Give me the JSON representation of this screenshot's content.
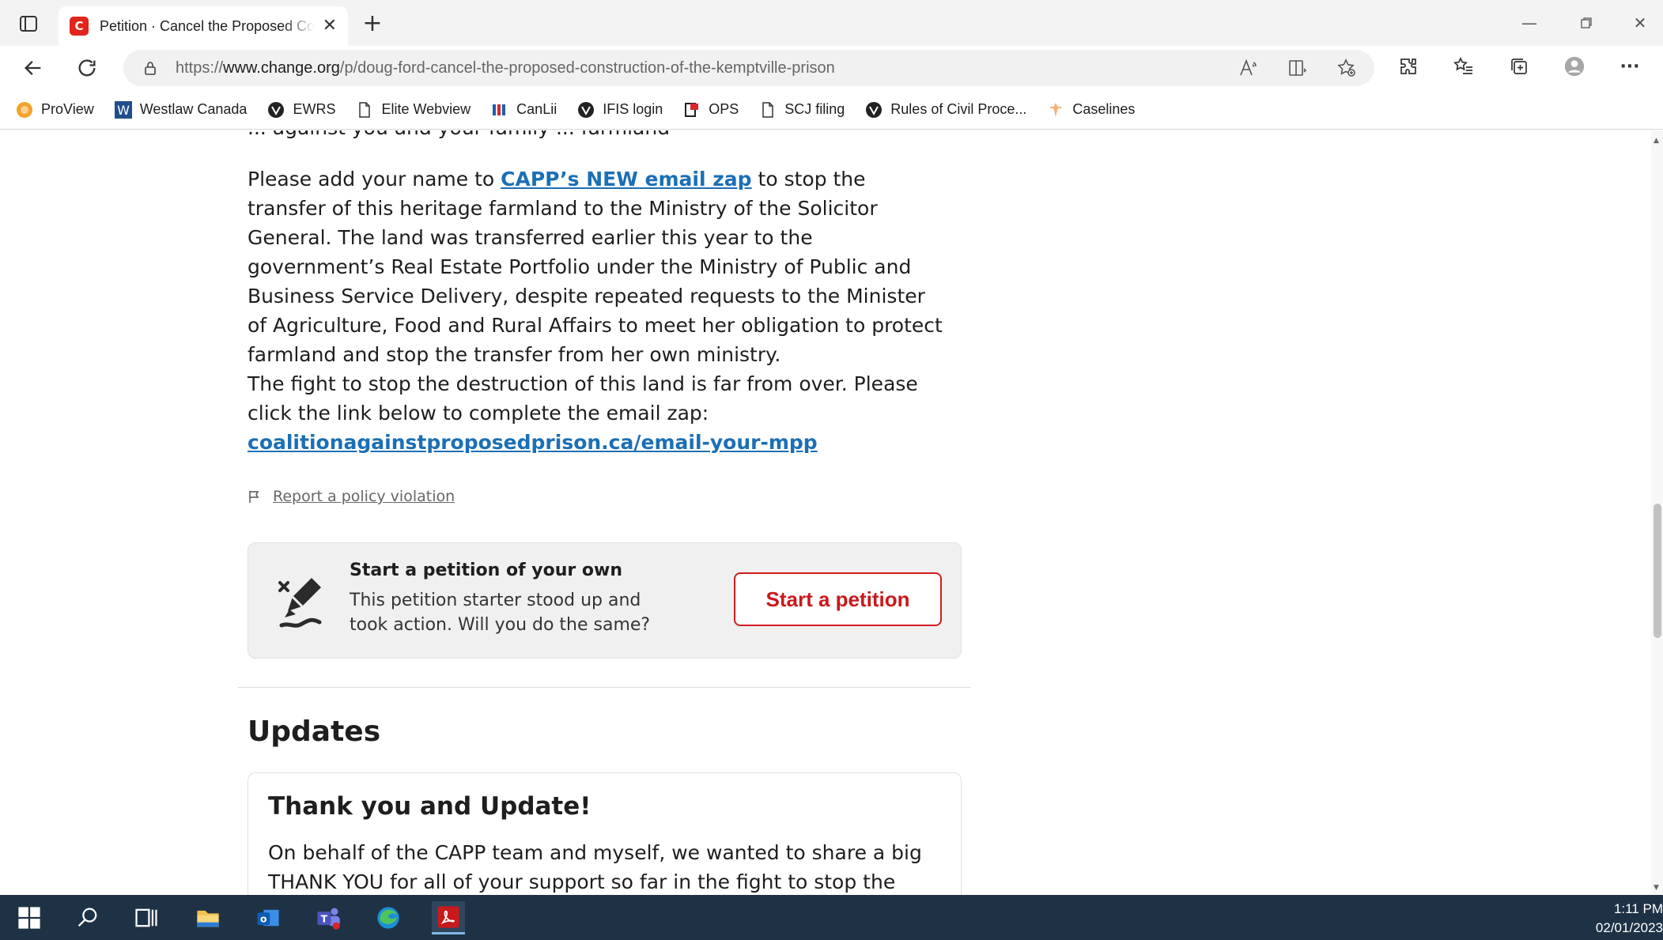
{
  "browser": {
    "tab_title": "Petition · Cancel the Proposed Construction of the Kemptville Prison",
    "tab_favicon_letter": "C",
    "url_prefix": "https://",
    "url_domain": "www.change.org",
    "url_path": "/p/doug-ford-cancel-the-proposed-construction-of-the-kemptville-prison"
  },
  "bookmarks": [
    {
      "label": "ProView",
      "icon": "proview-icon"
    },
    {
      "label": "Westlaw Canada",
      "icon": "westlaw-icon"
    },
    {
      "label": "EWRS",
      "icon": "shield-icon"
    },
    {
      "label": "Elite Webview",
      "icon": "page-icon"
    },
    {
      "label": "CanLii",
      "icon": "canlii-icon"
    },
    {
      "label": "IFIS login",
      "icon": "shield-icon"
    },
    {
      "label": "OPS",
      "icon": "ops-icon"
    },
    {
      "label": "SCJ filing",
      "icon": "page-icon"
    },
    {
      "label": "Rules of Civil Proce...",
      "icon": "shield-icon"
    },
    {
      "label": "Caselines",
      "icon": "caselines-icon"
    }
  ],
  "content": {
    "cut_line": "... against you and your family ... farmland",
    "para1_before": "Please add your name to ",
    "para1_link": "CAPP’s NEW email zap",
    "para1_after": " to stop the transfer of this heritage farmland to the Ministry of the Solicitor General. The land was transferred earlier this year to the government’s Real Estate Portfolio under the Ministry of Public and Business Service Delivery, despite repeated requests to the Minister of Agriculture, Food and Rural Affairs to meet her obligation to protect farmland and stop the transfer from her own ministry.",
    "para2": "The fight to stop the destruction of this land is far from over. Please click the link below to complete the email zap:",
    "para2_link": "coalitionagainstproposedprison.ca/email-your-mpp",
    "report_label": "Report a policy violation",
    "card": {
      "title": "Start a petition of your own",
      "description": "This petition starter stood up and took action. Will you do the same?",
      "button": "Start a petition"
    },
    "updates_heading": "Updates",
    "update": {
      "title": "Thank you and Update!",
      "body": "On behalf of the CAPP team and myself, we wanted to share a big THANK YOU for all of your support so far in the fight to stop the construction of"
    }
  },
  "taskbar": {
    "time": "1:11 PM",
    "date": "02/01/2023"
  },
  "colors": {
    "link": "#1b6fb5",
    "brand_red": "#d21c1c",
    "taskbar": "#1f3245"
  }
}
